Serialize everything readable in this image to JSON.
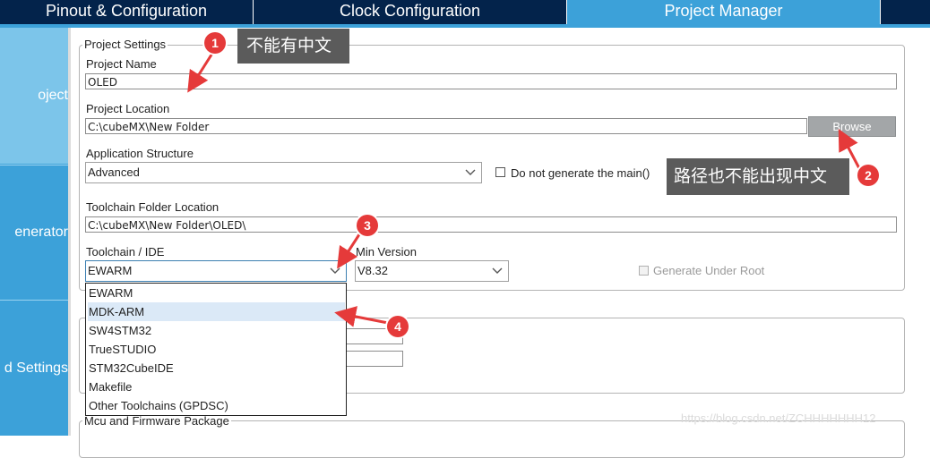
{
  "tabs": [
    {
      "label": "Pinout & Configuration",
      "active": false
    },
    {
      "label": "Clock Configuration",
      "active": false
    },
    {
      "label": "Project Manager",
      "active": true
    }
  ],
  "sidenav": {
    "items": [
      {
        "label": "oject"
      },
      {
        "label": "enerator"
      },
      {
        "label": "d Settings"
      }
    ]
  },
  "project_settings": {
    "legend": "Project Settings",
    "project_name_label": "Project Name",
    "project_name_value": "OLED",
    "project_location_label": "Project Location",
    "project_location_value": "C:\\cubeMX\\New Folder",
    "browse_label": "Browse",
    "app_structure_label": "Application Structure",
    "app_structure_value": "Advanced",
    "no_main_label": "Do not generate the main()",
    "toolchain_folder_label": "Toolchain Folder Location",
    "toolchain_folder_value": "C:\\cubeMX\\New Folder\\OLED\\",
    "toolchain_ide_label": "Toolchain / IDE",
    "toolchain_ide_value": "EWARM",
    "min_version_label": "Min Version",
    "min_version_value": "V8.32",
    "generate_under_root_label": "Generate Under Root"
  },
  "toolchain_options": [
    "EWARM",
    "MDK-ARM",
    "SW4STM32",
    "TrueSTUDIO",
    "STM32CubeIDE",
    "Makefile",
    "Other Toolchains (GPDSC)"
  ],
  "highlighted_option": "MDK-ARM",
  "mcu_section": {
    "legend": "Mcu and Firmware Package"
  },
  "annotations": [
    {
      "number": "1",
      "text": "不能有中文"
    },
    {
      "number": "2",
      "text": "路径也不能出现中文"
    },
    {
      "number": "3"
    },
    {
      "number": "4"
    }
  ],
  "watermark": "https://blog.csdn.net/ZCHHHHHHH12",
  "colors": {
    "tab_dark": "#03234b",
    "tab_active": "#3ca1d9",
    "nav_highlight": "#7cc5ea",
    "badge_red": "#e53a3a",
    "callout_bg": "#5b5b5b",
    "browse_bg": "#a3a6a8",
    "dropdown_hover": "#dbe9f7"
  },
  "icons": [
    "chevron-down-icon",
    "checkbox-icon",
    "arrow-icon"
  ]
}
